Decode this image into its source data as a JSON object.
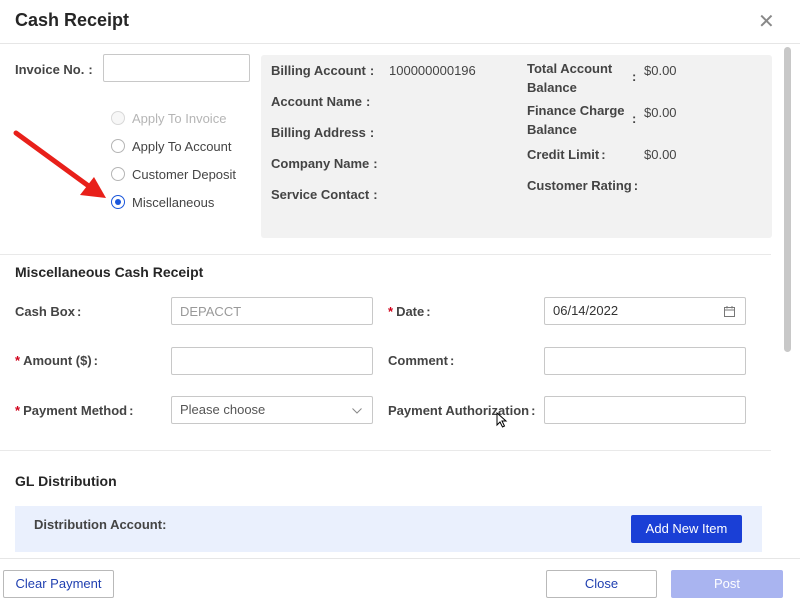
{
  "window": {
    "title": "Cash Receipt"
  },
  "invoice": {
    "label": "Invoice No.",
    "value": ""
  },
  "apply_options": [
    {
      "label": "Apply To Invoice",
      "state": "disabled"
    },
    {
      "label": "Apply To Account",
      "state": "unchecked"
    },
    {
      "label": "Customer Deposit",
      "state": "unchecked"
    },
    {
      "label": "Miscellaneous",
      "state": "checked"
    }
  ],
  "account_info": {
    "billing_account_label": "Billing Account",
    "billing_account_value": "100000000196",
    "account_name_label": "Account Name",
    "billing_address_label": "Billing Address",
    "company_name_label": "Company Name",
    "service_contact_label": "Service Contact",
    "total_balance_label_1": "Total Account",
    "total_balance_label_2": "Balance",
    "total_balance_value": "$0.00",
    "finance_charge_label_1": "Finance Charge",
    "finance_charge_label_2": "Balance",
    "finance_charge_value": "$0.00",
    "credit_limit_label": "Credit Limit",
    "credit_limit_value": "$0.00",
    "customer_rating_label": "Customer Rating",
    "colon": ":"
  },
  "misc": {
    "section_title": "Miscellaneous Cash Receipt",
    "cash_box_label": "Cash Box",
    "cash_box_value": "DEPACCT",
    "date_label": "Date",
    "date_value": "06/14/2022",
    "amount_label": "Amount ($)",
    "amount_value": "",
    "comment_label": "Comment",
    "comment_value": "",
    "payment_method_label": "Payment Method",
    "payment_method_placeholder": "Please choose",
    "payment_auth_label": "Payment Authorization",
    "payment_auth_value": "",
    "required_mark": "*",
    "colon": ":"
  },
  "gl": {
    "section_title": "GL Distribution",
    "distribution_account_label": "Distribution Account:",
    "add_new_item_label": "Add New Item"
  },
  "footer": {
    "clear_payment_label": "Clear Payment",
    "close_label": "Close",
    "post_label": "Post"
  },
  "colors": {
    "primary": "#1a3fd6",
    "required": "#d0021b",
    "annotation_arrow": "#e8201a",
    "disabled_post": "#a9b4f0"
  }
}
